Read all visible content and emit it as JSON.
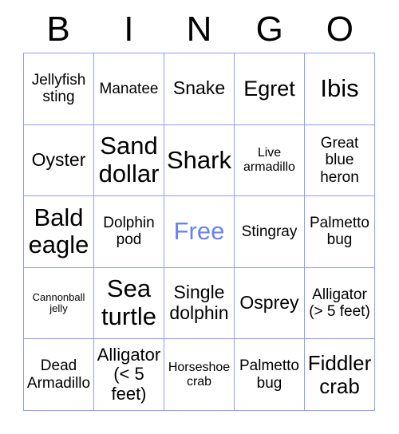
{
  "card": {
    "header": {
      "letters": [
        "B",
        "I",
        "N",
        "G",
        "O"
      ]
    },
    "rows": [
      [
        {
          "text": "Jellyfish sting",
          "size": "fs-md",
          "free": false
        },
        {
          "text": "Manatee",
          "size": "fs-md",
          "free": false
        },
        {
          "text": "Snake",
          "size": "fs-lg",
          "free": false
        },
        {
          "text": "Egret",
          "size": "fs-xl",
          "free": false
        },
        {
          "text": "Ibis",
          "size": "fs-xxl",
          "free": false
        }
      ],
      [
        {
          "text": "Oyster",
          "size": "fs-lg",
          "free": false
        },
        {
          "text": "Sand dollar",
          "size": "fs-xxl",
          "free": false
        },
        {
          "text": "Shark",
          "size": "fs-xxl",
          "free": false
        },
        {
          "text": "Live armadillo",
          "size": "fs-sm",
          "free": false
        },
        {
          "text": "Great blue heron",
          "size": "fs-md",
          "free": false
        }
      ],
      [
        {
          "text": "Bald eagle",
          "size": "fs-xxl",
          "free": false
        },
        {
          "text": "Dolphin pod",
          "size": "fs-md",
          "free": false
        },
        {
          "text": "Free",
          "size": "fs-xxl",
          "free": true
        },
        {
          "text": "Stingray",
          "size": "fs-md",
          "free": false
        },
        {
          "text": "Palmetto bug",
          "size": "fs-md",
          "free": false
        }
      ],
      [
        {
          "text": "Cannonball jelly",
          "size": "fs-xs",
          "free": false
        },
        {
          "text": "Sea turtle",
          "size": "fs-xxl",
          "free": false
        },
        {
          "text": "Single dolphin",
          "size": "fs-lg",
          "free": false
        },
        {
          "text": "Osprey",
          "size": "fs-lg",
          "free": false
        },
        {
          "text": "Alligator (> 5 feet)",
          "size": "fs-md",
          "free": false
        }
      ],
      [
        {
          "text": "Dead Armadillo",
          "size": "fs-md",
          "free": false
        },
        {
          "text": "Alligator (< 5 feet)",
          "size": "fs-lg",
          "free": false
        },
        {
          "text": "Horseshoe crab",
          "size": "fs-sm",
          "free": false
        },
        {
          "text": "Palmetto bug",
          "size": "fs-md",
          "free": false
        },
        {
          "text": "Fiddler crab",
          "size": "fs-xl",
          "free": false
        }
      ]
    ],
    "colors": {
      "border": "#8c9eff",
      "text": "#000000",
      "free_text": "#6a82f0",
      "background": "#ffffff"
    }
  }
}
